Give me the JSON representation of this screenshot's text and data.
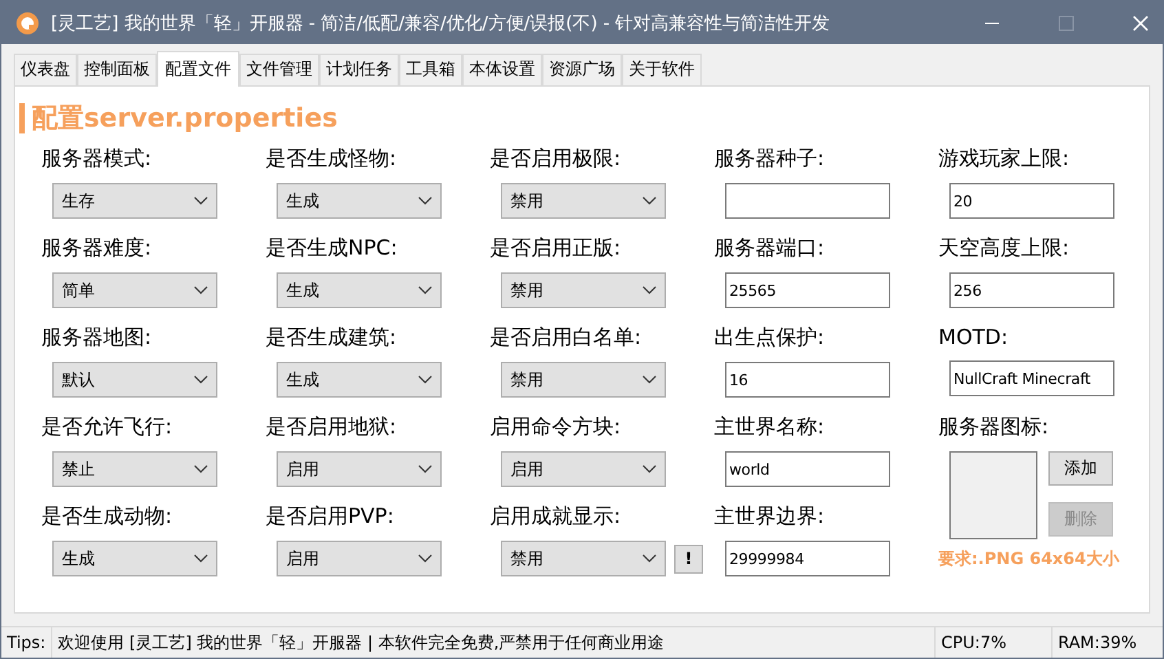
{
  "window": {
    "title": "[灵工艺] 我的世界「轻」开服器 - 简洁/低配/兼容/优化/方便/误报(不)  - 针对高兼容性与简洁性开发"
  },
  "tabs": [
    {
      "label": "仪表盘",
      "selected": false
    },
    {
      "label": "控制面板",
      "selected": false
    },
    {
      "label": "配置文件",
      "selected": true
    },
    {
      "label": "文件管理",
      "selected": false
    },
    {
      "label": "计划任务",
      "selected": false
    },
    {
      "label": "工具箱",
      "selected": false
    },
    {
      "label": "本体设置",
      "selected": false
    },
    {
      "label": "资源广场",
      "selected": false
    },
    {
      "label": "关于软件",
      "selected": false
    }
  ],
  "heading": {
    "prefix": "配置",
    "file": "server.properties"
  },
  "fields": [
    {
      "kind": "select",
      "label": "服务器模式:",
      "value": "生存"
    },
    {
      "kind": "select",
      "label": "服务器难度:",
      "value": "简单"
    },
    {
      "kind": "select",
      "label": "服务器地图:",
      "value": "默认"
    },
    {
      "kind": "select",
      "label": "是否允许飞行:",
      "value": "禁止"
    },
    {
      "kind": "select",
      "label": "是否生成动物:",
      "value": "生成"
    },
    {
      "kind": "select",
      "label": "是否生成怪物:",
      "value": "生成"
    },
    {
      "kind": "select",
      "label": "是否生成NPC:",
      "value": "生成"
    },
    {
      "kind": "select",
      "label": "是否生成建筑:",
      "value": "生成"
    },
    {
      "kind": "select",
      "label": "是否启用地狱:",
      "value": "启用"
    },
    {
      "kind": "select",
      "label": "是否启用PVP:",
      "value": "启用"
    },
    {
      "kind": "select",
      "label": "是否启用极限:",
      "value": "禁用"
    },
    {
      "kind": "select",
      "label": "是否启用正版:",
      "value": "禁用"
    },
    {
      "kind": "select",
      "label": "是否启用白名单:",
      "value": "禁用"
    },
    {
      "kind": "select",
      "label": "启用命令方块:",
      "value": "启用"
    },
    {
      "kind": "select",
      "label": "启用成就显示:",
      "value": "禁用",
      "button": "!"
    },
    {
      "kind": "text",
      "label": "服务器种子:"
    },
    {
      "kind": "text",
      "label": "服务器端口:",
      "value": "25565"
    },
    {
      "kind": "text",
      "label": "出生点保护:",
      "value": "16"
    },
    {
      "kind": "text",
      "label": "主世界名称:",
      "value": "world"
    },
    {
      "kind": "text",
      "label": "主世界边界:",
      "value": "29999984"
    },
    {
      "kind": "text",
      "label": "游戏玩家上限:",
      "value": "20"
    },
    {
      "kind": "text",
      "label": "天空高度上限:",
      "value": "256"
    },
    {
      "kind": "text",
      "label": "MOTD:",
      "value": "NullCraft Minecraft"
    },
    {
      "kind": "icon",
      "label": "服务器图标:",
      "add": "添加",
      "remove": "删除",
      "remove_disabled": true,
      "note": "要求:.PNG 64x64大小"
    }
  ],
  "status_bar": {
    "tips_label": "Tips:",
    "message": "欢迎使用 [灵工艺] 我的世界「轻」开服器 | 本软件完全免费,严禁用于任何商业用途",
    "cpu": "CPU:7%",
    "ram": "RAM:39%"
  }
}
